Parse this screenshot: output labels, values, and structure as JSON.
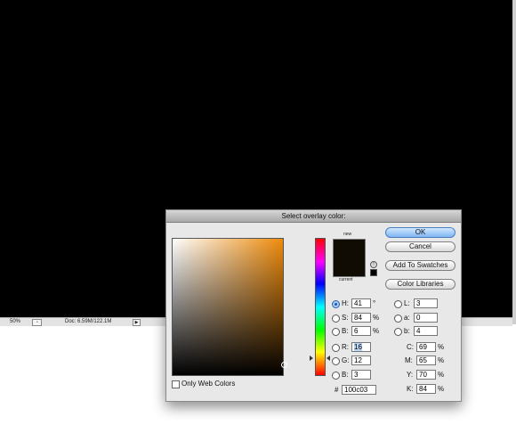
{
  "statusbar": {
    "zoom": "50%",
    "doc_info": "Doc: 6.59M/122.1M",
    "arrow_glyph": "▶"
  },
  "dialog": {
    "title": "Select overlay color:",
    "new_label": "new",
    "current_label": "current",
    "swatch_color": "#100c03",
    "field_hue_color": "#ee8b0c",
    "buttons": {
      "ok": "OK",
      "cancel": "Cancel",
      "add_to_swatches": "Add To Swatches",
      "color_libraries": "Color Libraries"
    },
    "hsb": {
      "h": {
        "label": "H:",
        "value": "41",
        "unit": "°",
        "selected": true
      },
      "s": {
        "label": "S:",
        "value": "84",
        "unit": "%"
      },
      "b": {
        "label": "B:",
        "value": "6",
        "unit": "%"
      }
    },
    "rgb": {
      "r": {
        "label": "R:",
        "value": "16"
      },
      "g": {
        "label": "G:",
        "value": "12"
      },
      "b": {
        "label": "B:",
        "value": "3"
      }
    },
    "lab": {
      "l": {
        "label": "L:",
        "value": "3"
      },
      "a": {
        "label": "a:",
        "value": "0"
      },
      "b": {
        "label": "b:",
        "value": "4"
      }
    },
    "cmyk": {
      "c": {
        "label": "C:",
        "value": "69",
        "unit": "%"
      },
      "m": {
        "label": "M:",
        "value": "65",
        "unit": "%"
      },
      "y": {
        "label": "Y:",
        "value": "70",
        "unit": "%"
      },
      "k": {
        "label": "K:",
        "value": "84",
        "unit": "%"
      }
    },
    "hex": {
      "label": "#",
      "value": "100c03"
    },
    "only_web_colors": {
      "label": "Only Web Colors",
      "checked": false
    }
  }
}
